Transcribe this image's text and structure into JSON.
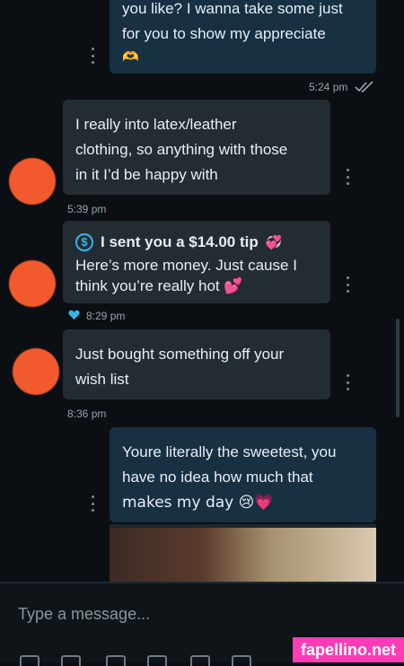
{
  "messages": [
    {
      "id": "m0",
      "direction": "outgoing",
      "line1": "you like? I wanna take some just",
      "line2": "for you to show my appreciate",
      "line3": "🫶",
      "time": "5:24 pm",
      "read_icon": "double-check-icon"
    },
    {
      "id": "m1",
      "direction": "incoming",
      "lines": [
        "I really into latex/leather",
        "clothing, so anything with those",
        "in it I’d be happy with"
      ],
      "time": "5:39 pm"
    },
    {
      "id": "m2",
      "direction": "incoming",
      "tip_title": "I sent you a $14.00 tip",
      "tip_emoji": "💞",
      "lines": [
        "Here’s more money. Just cause I",
        "think you’re really hot 💕"
      ],
      "time": "8:29 pm",
      "liked_icon": "heart-icon"
    },
    {
      "id": "m3",
      "direction": "incoming",
      "lines": [
        "Just bought something off your",
        "wish list"
      ],
      "time": "8:36 pm"
    },
    {
      "id": "m4",
      "direction": "outgoing",
      "lines": [
        "Youre literally the sweetest, you",
        "have no idea how much that",
        "makes my day 😢💗"
      ]
    }
  ],
  "composer": {
    "placeholder": "Type a message..."
  },
  "watermark": "fapellino.net",
  "colors": {
    "accent": "#36b6e9",
    "incoming_bubble": "#242c33",
    "outgoing_bubble": "#173042",
    "avatar_redaction": "#f25a2d"
  }
}
